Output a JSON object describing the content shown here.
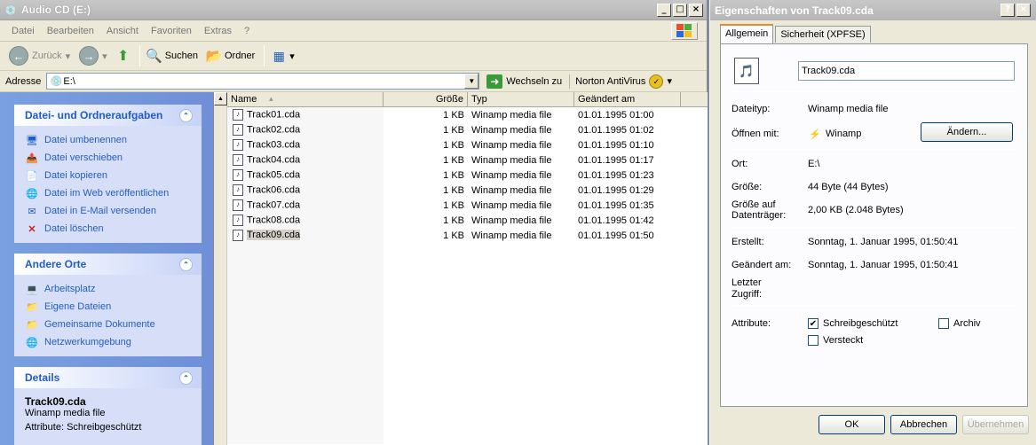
{
  "explorer": {
    "title": "Audio CD (E:)",
    "menu": [
      "Datei",
      "Bearbeiten",
      "Ansicht",
      "Favoriten",
      "Extras",
      "?"
    ],
    "toolbar": {
      "back": "Zurück",
      "search": "Suchen",
      "folders": "Ordner"
    },
    "address": {
      "label": "Adresse",
      "value": "E:\\",
      "go": "Wechseln zu",
      "norton": "Norton AntiVirus"
    },
    "tasks": {
      "title": "Datei- und Ordneraufgaben",
      "items": [
        "Datei umbenennen",
        "Datei verschieben",
        "Datei kopieren",
        "Datei im Web veröffentlichen",
        "Datei in E-Mail versenden",
        "Datei löschen"
      ]
    },
    "places": {
      "title": "Andere Orte",
      "items": [
        "Arbeitsplatz",
        "Eigene Dateien",
        "Gemeinsame Dokumente",
        "Netzwerkumgebung"
      ]
    },
    "details": {
      "title": "Details",
      "name": "Track09.cda",
      "type": "Winamp media file",
      "attr": "Attribute: Schreibgeschützt"
    },
    "columns": {
      "name": "Name",
      "size": "Größe",
      "type": "Typ",
      "modified": "Geändert am"
    },
    "files": [
      {
        "name": "Track01.cda",
        "size": "1 KB",
        "type": "Winamp media file",
        "modified": "01.01.1995 01:00"
      },
      {
        "name": "Track02.cda",
        "size": "1 KB",
        "type": "Winamp media file",
        "modified": "01.01.1995 01:02"
      },
      {
        "name": "Track03.cda",
        "size": "1 KB",
        "type": "Winamp media file",
        "modified": "01.01.1995 01:10"
      },
      {
        "name": "Track04.cda",
        "size": "1 KB",
        "type": "Winamp media file",
        "modified": "01.01.1995 01:17"
      },
      {
        "name": "Track05.cda",
        "size": "1 KB",
        "type": "Winamp media file",
        "modified": "01.01.1995 01:23"
      },
      {
        "name": "Track06.cda",
        "size": "1 KB",
        "type": "Winamp media file",
        "modified": "01.01.1995 01:29"
      },
      {
        "name": "Track07.cda",
        "size": "1 KB",
        "type": "Winamp media file",
        "modified": "01.01.1995 01:35"
      },
      {
        "name": "Track08.cda",
        "size": "1 KB",
        "type": "Winamp media file",
        "modified": "01.01.1995 01:42"
      },
      {
        "name": "Track09.cda",
        "size": "1 KB",
        "type": "Winamp media file",
        "modified": "01.01.1995 01:50"
      }
    ],
    "selected_index": 8
  },
  "dialog": {
    "title": "Eigenschaften von Track09.cda",
    "tabs": [
      "Allgemein",
      "Sicherheit (XPFSE)"
    ],
    "filename": "Track09.cda",
    "labels": {
      "filetype": "Dateityp:",
      "openwith": "Öffnen mit:",
      "location": "Ort:",
      "size": "Größe:",
      "size_on_disk": "Größe auf Datenträger:",
      "created": "Erstellt:",
      "modified": "Geändert am:",
      "accessed": "Letzter Zugriff:",
      "attributes": "Attribute:"
    },
    "values": {
      "filetype": "Winamp media file",
      "openwith": "Winamp",
      "location": "E:\\",
      "size": "44 Byte (44 Bytes)",
      "size_on_disk": "2,00 KB (2.048 Bytes)",
      "created": "Sonntag, 1. Januar 1995, 01:50:41",
      "modified": "Sonntag, 1. Januar 1995, 01:50:41",
      "accessed": ""
    },
    "change_button": "Ändern...",
    "attributes": {
      "readonly": "Schreibgeschützt",
      "hidden": "Versteckt",
      "archive": "Archiv"
    },
    "buttons": {
      "ok": "OK",
      "cancel": "Abbrechen",
      "apply": "Übernehmen"
    }
  },
  "colors": {
    "task_blue": "#215dc6",
    "pane_blue": "#7aa0e0",
    "dialog_bg": "#ece9d8"
  }
}
